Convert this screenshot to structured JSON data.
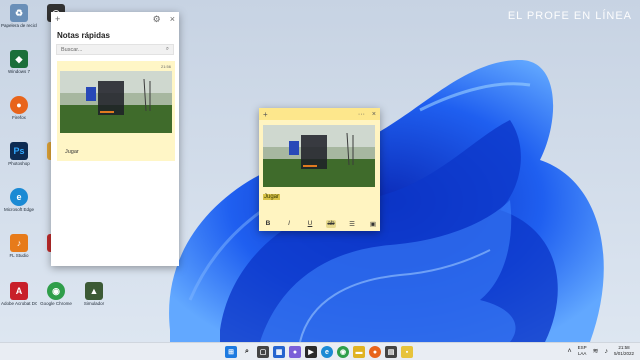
{
  "watermark": "EL PROFE EN LÍNEA",
  "desktop_icons": [
    {
      "label": "Papelera de reciclaje",
      "icon": "recycle-bin-icon",
      "color": "#6a8fb8"
    },
    {
      "label": "Windows 7",
      "icon": "app-icon",
      "color": "#1b6f3a"
    },
    {
      "label": "Firefox",
      "icon": "firefox-icon",
      "color": "#e8641b"
    },
    {
      "label": "Photoshop",
      "icon": "photoshop-icon",
      "color": "#0d2b52"
    },
    {
      "label": "Microsoft Edge",
      "icon": "edge-icon",
      "color": "#1b8ad4"
    },
    {
      "label": "FL Studio",
      "icon": "fl-studio-icon",
      "color": "#e77b1a"
    },
    {
      "label": "Adobe Acrobat DC",
      "icon": "acrobat-icon",
      "color": "#c8202a"
    },
    {
      "label": "Google Chrome",
      "icon": "chrome-icon",
      "color": "#2f9e4a"
    },
    {
      "label": "Simulador",
      "icon": "game-icon",
      "color": "#3c5a35"
    }
  ],
  "notes_panel": {
    "title": "Notas rápidas",
    "search_placeholder": "Buscar...",
    "note": {
      "time": "21:56",
      "text": "Jugar"
    }
  },
  "sticky": {
    "selected_text": "Jugar",
    "format": {
      "bold": "B",
      "italic": "I",
      "underline": "U",
      "strike": "ab",
      "list": "☰",
      "image": "▣"
    }
  },
  "taskbar": {
    "lang_top": "ESP",
    "lang_bottom": "LAA",
    "time": "21:58",
    "date": "5/01/2022"
  }
}
